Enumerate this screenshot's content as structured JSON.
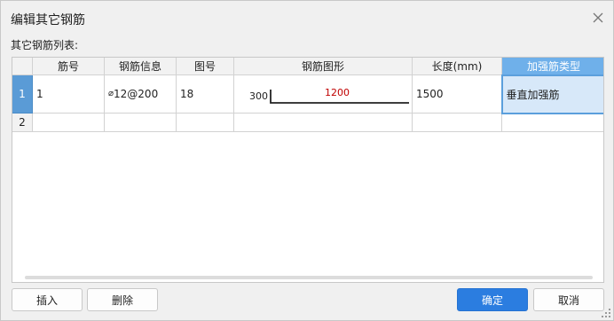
{
  "dialog": {
    "title": "编辑其它钢筋",
    "subtitle": "其它钢筋列表:"
  },
  "grid": {
    "columns": [
      "",
      "筋号",
      "钢筋信息",
      "图号",
      "钢筋图形",
      "长度(mm)",
      "加强筋类型"
    ],
    "active_column": 6,
    "rows": [
      {
        "num": "1",
        "bar_no": "1",
        "bar_info": "12@200",
        "bar_grade_symbol": "⌀",
        "figure_no": "18",
        "shape": {
          "hook_length": "300",
          "main_length": "1200"
        },
        "length": "1500",
        "type": "垂直加强筋"
      },
      {
        "num": "2",
        "bar_no": "",
        "bar_info": "",
        "bar_grade_symbol": "",
        "figure_no": "",
        "shape": {
          "hook_length": "",
          "main_length": ""
        },
        "length": "",
        "type": ""
      }
    ]
  },
  "buttons": {
    "insert": "插入",
    "delete": "删除",
    "ok": "确定",
    "cancel": "取消"
  },
  "colors": {
    "accent": "#2b7de0",
    "header_active": "#6fb0ea",
    "shape_label": "#c00000"
  }
}
